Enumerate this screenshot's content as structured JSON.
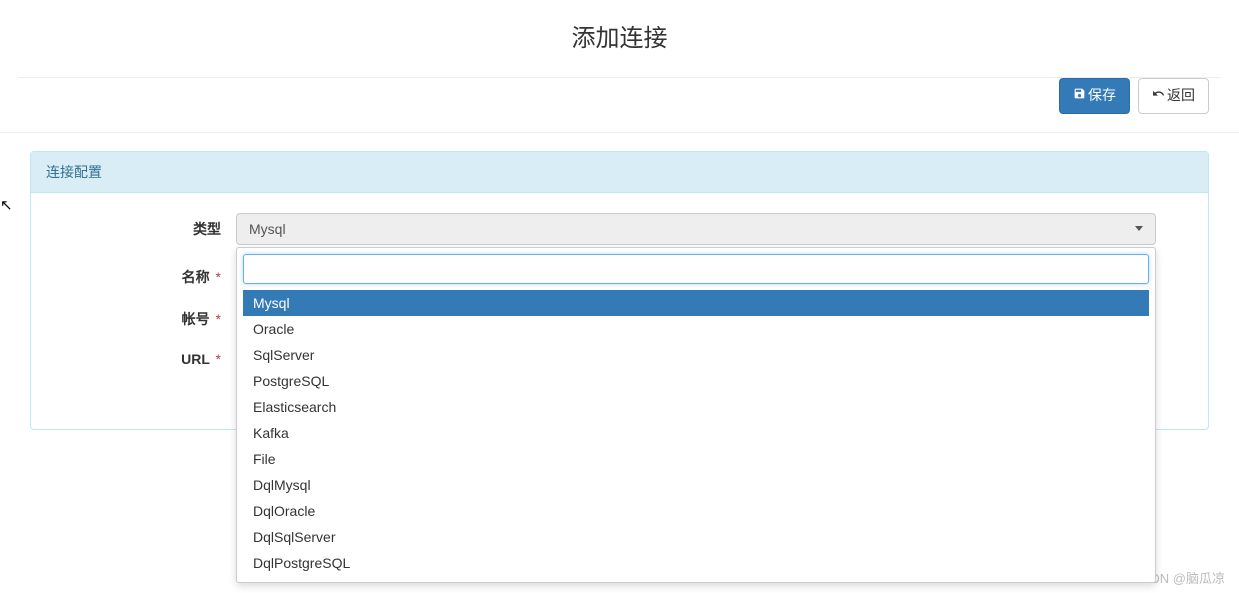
{
  "page": {
    "title": "添加连接"
  },
  "toolbar": {
    "save_label": "保存",
    "back_label": "返回"
  },
  "panel": {
    "heading": "连接配置"
  },
  "form": {
    "type": {
      "label": "类型",
      "selected": "Mysql"
    },
    "name": {
      "label": "名称",
      "required": "*"
    },
    "account": {
      "label": "帐号",
      "required": "*"
    },
    "url": {
      "label": "URL",
      "required": "*"
    }
  },
  "dropdown": {
    "search_value": "",
    "options": [
      "Mysql",
      "Oracle",
      "SqlServer",
      "PostgreSQL",
      "Elasticsearch",
      "Kafka",
      "File",
      "DqlMysql",
      "DqlOracle",
      "DqlSqlServer",
      "DqlPostgreSQL"
    ],
    "selected_index": 0
  },
  "watermark": "CSDN @脑瓜凉"
}
